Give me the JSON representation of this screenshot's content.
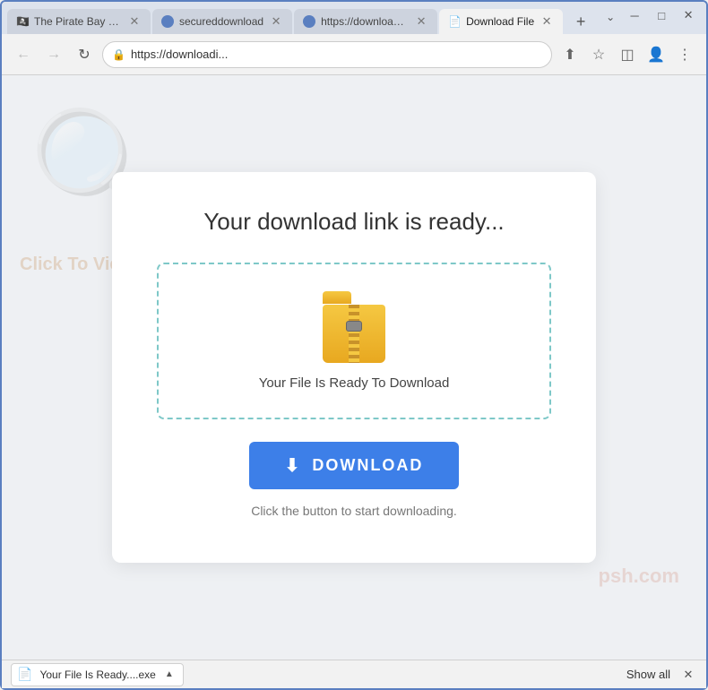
{
  "browser": {
    "tabs": [
      {
        "id": "tab1",
        "label": "The Pirate Bay - T...",
        "favicon": "🏴‍☠️",
        "active": false
      },
      {
        "id": "tab2",
        "label": "secureddownload",
        "favicon": "🔵",
        "active": false
      },
      {
        "id": "tab3",
        "label": "https://downloadi...",
        "favicon": "🔵",
        "active": false
      },
      {
        "id": "tab4",
        "label": "Download File",
        "favicon": "📄",
        "active": true
      }
    ],
    "address": "https://downloadi...",
    "window_controls": {
      "minimize": "─",
      "maximize": "□",
      "close": "✕"
    }
  },
  "page": {
    "title": "Your download link is ready...",
    "file_box": {
      "file_label": "Your File Is Ready To Download"
    },
    "download_button": "DOWNLOAD",
    "instruction": "Click the button to start downloading."
  },
  "watermark": {
    "text": "Click To View",
    "brand": "psh.com"
  },
  "status_bar": {
    "filename": "Your File Is Ready....exe",
    "show_all": "Show all"
  }
}
